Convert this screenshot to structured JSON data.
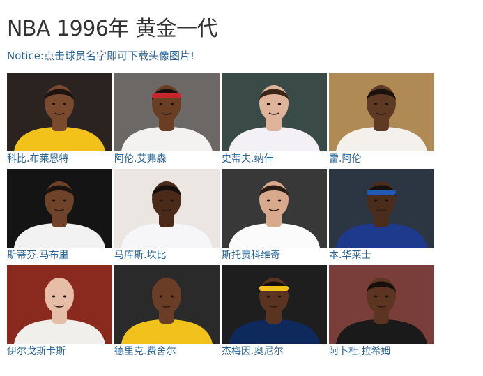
{
  "header": {
    "title": "NBA 1996年 黄金一代",
    "notice": "Notice:点击球员名字即可下载头像图片!"
  },
  "players": [
    {
      "name": "科比.布莱恩特",
      "bg": "#2a2320",
      "skin": "#7a4a2e",
      "jersey": "#f2c21a",
      "hair": "#1c1410",
      "headband": ""
    },
    {
      "name": "阿伦.艾弗森",
      "bg": "#6c6866",
      "skin": "#6a3e25",
      "jersey": "#f4f2f0",
      "hair": "#1a120d",
      "headband": "#c8282d"
    },
    {
      "name": "史蒂夫.纳什",
      "bg": "#3a4a46",
      "skin": "#e0b49a",
      "jersey": "#f3f1f5",
      "hair": "#3a2616",
      "headband": ""
    },
    {
      "name": "雷.阿伦",
      "bg": "#b08a55",
      "skin": "#5e3a24",
      "jersey": "#f4f1ec",
      "hair": "#1a120d",
      "headband": ""
    },
    {
      "name": "斯蒂芬.马布里",
      "bg": "#141414",
      "skin": "#6e4329",
      "jersey": "#f2f2f2",
      "hair": "#1a120d",
      "headband": ""
    },
    {
      "name": "马库斯.坎比",
      "bg": "#ebe6e2",
      "skin": "#4a2b1a",
      "jersey": "#f6f6f8",
      "hair": "#150e0a",
      "headband": ""
    },
    {
      "name": "斯托贾科维奇",
      "bg": "#383838",
      "skin": "#d9a98d",
      "jersey": "#fbfbfb",
      "hair": "#2a1c12",
      "headband": ""
    },
    {
      "name": "本.华莱士",
      "bg": "#2c3542",
      "skin": "#4a2c1c",
      "jersey": "#1d3a8c",
      "hair": "#15100c",
      "headband": "#2458b5"
    },
    {
      "name": "伊尔戈斯卡斯",
      "bg": "#8a2a1e",
      "skin": "#e6bda6",
      "jersey": "#f1efec",
      "hair": "#e6bda6",
      "headband": ""
    },
    {
      "name": "德里克.费舍尔",
      "bg": "#2a2a2a",
      "skin": "#6a3e26",
      "jersey": "#f0c21b",
      "hair": "#6a3e26",
      "headband": ""
    },
    {
      "name": "杰梅因.奥尼尔",
      "bg": "#1e1e1e",
      "skin": "#5a3420",
      "jersey": "#0e2a5c",
      "hair": "#15100c",
      "headband": "#f1c21a"
    },
    {
      "name": "阿卜杜.拉希姆",
      "bg": "#7a3e3a",
      "skin": "#5c3522",
      "jersey": "#1a1a1a",
      "hair": "#15100c",
      "headband": ""
    }
  ]
}
